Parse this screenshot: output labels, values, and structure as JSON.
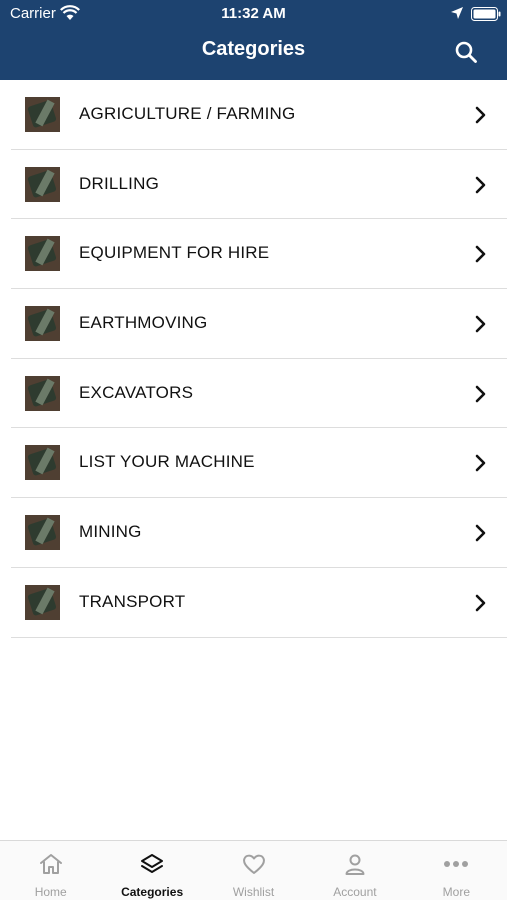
{
  "status_bar": {
    "carrier": "Carrier",
    "time": "11:32 AM"
  },
  "header": {
    "title": "Categories"
  },
  "categories": [
    {
      "label": "AGRICULTURE / FARMING"
    },
    {
      "label": "DRILLING"
    },
    {
      "label": "EQUIPMENT FOR HIRE"
    },
    {
      "label": "EARTHMOVING"
    },
    {
      "label": "EXCAVATORS"
    },
    {
      "label": "LIST YOUR MACHINE"
    },
    {
      "label": "MINING"
    },
    {
      "label": "TRANSPORT"
    }
  ],
  "tabbar": {
    "tabs": [
      {
        "label": "Home",
        "icon": "home-icon",
        "active": false
      },
      {
        "label": "Categories",
        "icon": "layers-icon",
        "active": true
      },
      {
        "label": "Wishlist",
        "icon": "heart-icon",
        "active": false
      },
      {
        "label": "Account",
        "icon": "person-icon",
        "active": false
      },
      {
        "label": "More",
        "icon": "more-icon",
        "active": false
      }
    ]
  },
  "colors": {
    "header": "#1d4370",
    "active_tab": "#111111",
    "inactive_tab": "#a0a0a0"
  }
}
